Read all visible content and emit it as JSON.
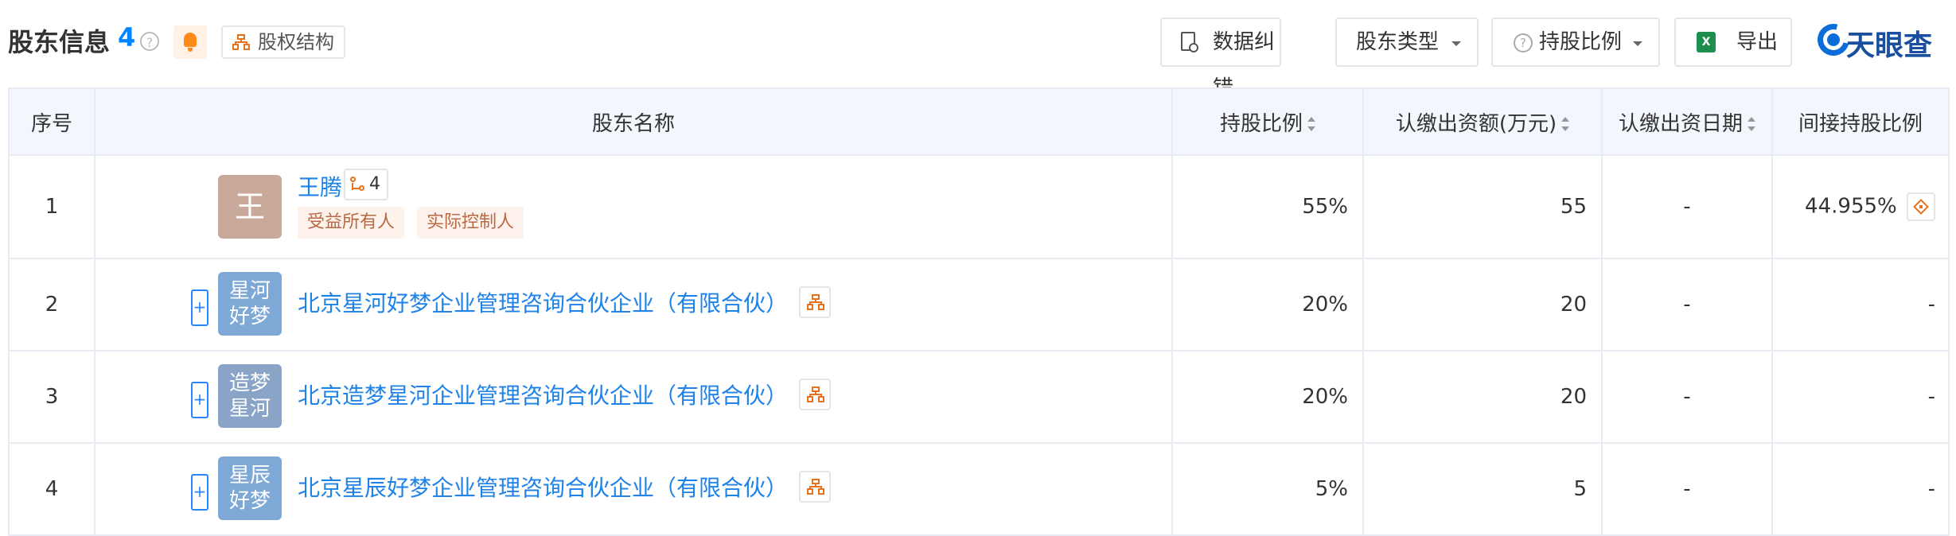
{
  "header": {
    "title": "股东信息",
    "count": "4",
    "help": "?",
    "equity_label": "股权结构"
  },
  "toolbar": {
    "correct_label": "数据纠错",
    "type_label": "股东类型",
    "ratio_help": "?",
    "ratio_label": "持股比例",
    "export_icon": "X",
    "export_label": "导出"
  },
  "logo": {
    "text": "天眼查"
  },
  "table": {
    "headers": [
      "序号",
      "股东名称",
      "持股比例",
      "认缴出资额(万元)",
      "认缴出资日期",
      "间接持股比例"
    ],
    "rows": [
      {
        "index": "1",
        "avatar": "王",
        "name": "王腾",
        "relation_count": "4",
        "tags": [
          "受益所有人",
          "实际控制人"
        ],
        "ratio": "55%",
        "amount": "55",
        "date": "-",
        "indirect": "44.955%"
      },
      {
        "index": "2",
        "expand": "+",
        "avatar_line1": "星河",
        "avatar_line2": "好梦",
        "name": "北京星河好梦企业管理咨询合伙企业（有限合伙）",
        "ratio": "20%",
        "amount": "20",
        "date": "-",
        "indirect": "-"
      },
      {
        "index": "3",
        "expand": "+",
        "avatar_line1": "造梦",
        "avatar_line2": "星河",
        "name": "北京造梦星河企业管理咨询合伙企业（有限合伙）",
        "ratio": "20%",
        "amount": "20",
        "date": "-",
        "indirect": "-"
      },
      {
        "index": "4",
        "expand": "+",
        "avatar_line1": "星辰",
        "avatar_line2": "好梦",
        "name": "北京星辰好梦企业管理咨询合伙企业（有限合伙）",
        "ratio": "5%",
        "amount": "5",
        "date": "-",
        "indirect": "-"
      }
    ]
  },
  "colors": {
    "link": "#1f82e8",
    "accent_orange": "#e8711e",
    "header_bg": "#f3f7fd",
    "tag_bg": "#fdf2ec",
    "tag_text": "#b86a45"
  }
}
